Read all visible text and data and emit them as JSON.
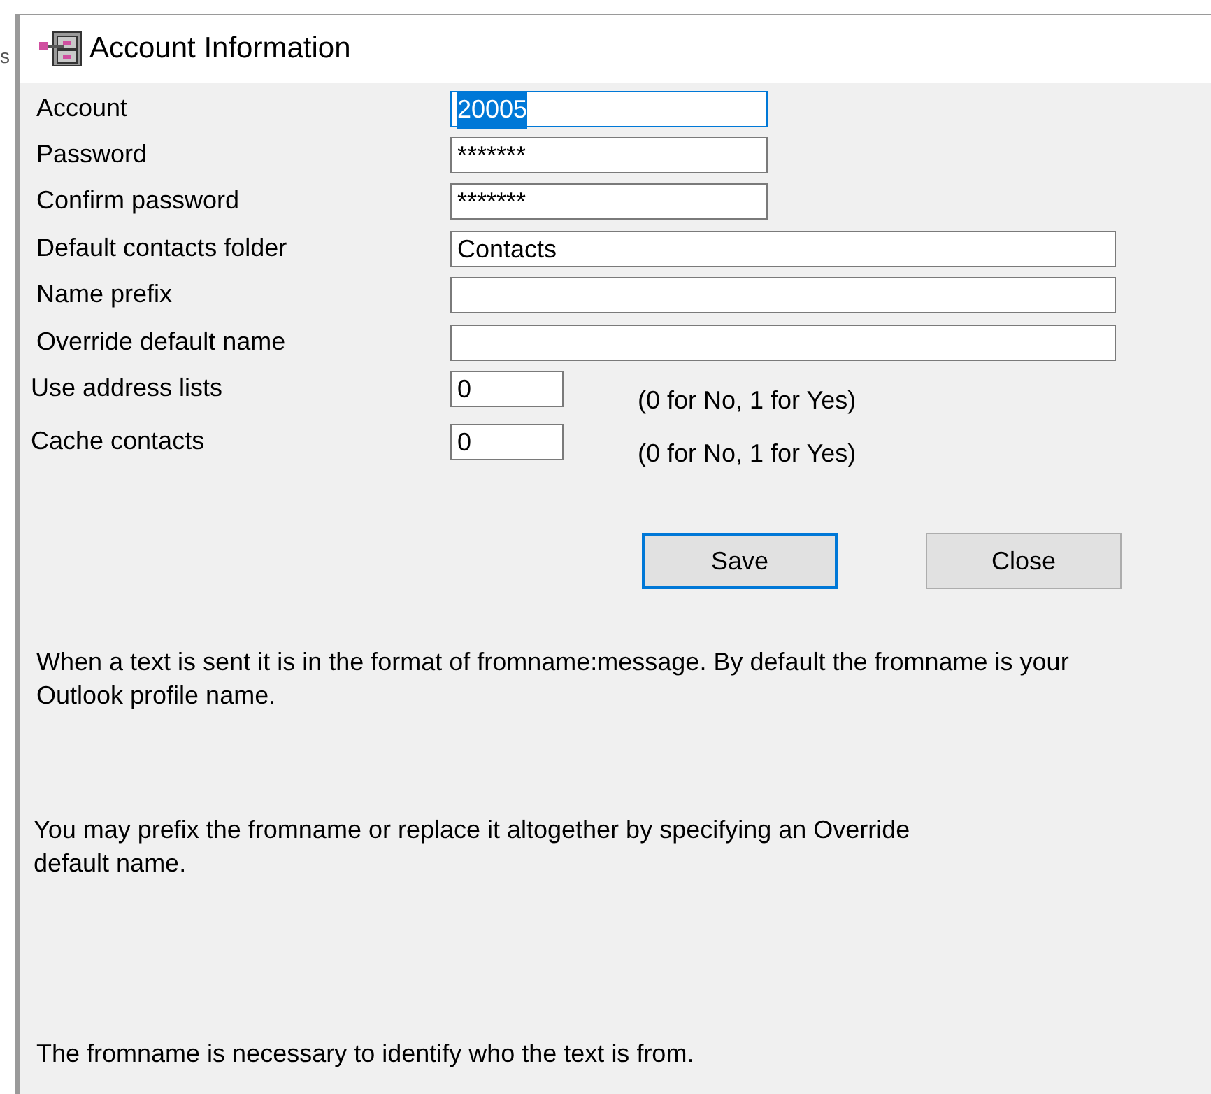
{
  "background_fragment": "s",
  "window": {
    "title": "Account Information"
  },
  "fields": [
    {
      "label": "Account",
      "value": "20005",
      "text_selected": true
    },
    {
      "label": "Password",
      "value": "*******",
      "text_selected": false
    },
    {
      "label": "Confirm password",
      "value": "*******",
      "text_selected": false
    },
    {
      "label": "Default contacts folder",
      "value": "Contacts",
      "text_selected": false
    },
    {
      "label": "Name prefix",
      "text_selected": false
    },
    {
      "label": "Override default name",
      "text_selected": false
    },
    {
      "label": "Use address lists",
      "value": "0",
      "hint": "(0 for No, 1 for Yes)",
      "text_selected": false
    },
    {
      "label": "Cache contacts",
      "value": "0",
      "hint": "(0 for No, 1 for Yes)",
      "text_selected": false
    }
  ],
  "buttons": [
    {
      "label": "Save",
      "focused": true
    },
    {
      "label": "Close",
      "focused": false
    }
  ],
  "notes": [
    "When a text is sent it is in the format of fromname:message. By default the fromname is your Outlook profile name.",
    "You may prefix the fromname or replace it altogether by specifying an Override default name.",
    "The fromname is necessary to identify who the text is from."
  ]
}
